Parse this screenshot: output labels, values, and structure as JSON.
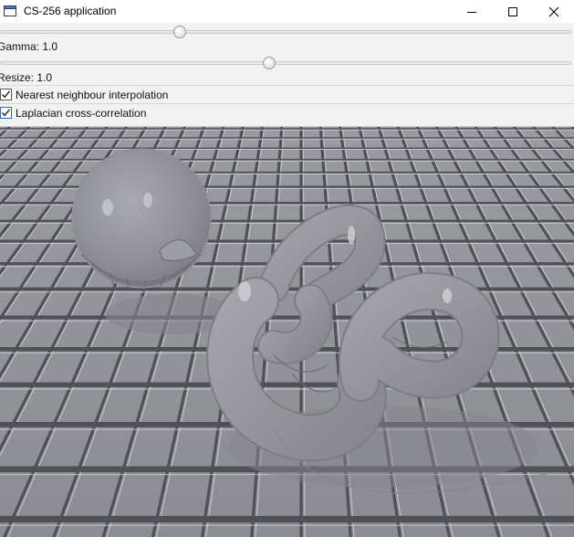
{
  "window": {
    "title": "CS-256 application",
    "controls": {
      "minimize_icon": "minimize-icon",
      "maximize_icon": "maximize-icon",
      "close_icon": "close-icon"
    }
  },
  "controls": {
    "slider1": {
      "value_fraction": 0.31
    },
    "gamma": {
      "label": "Gamma: 1.0",
      "value_fraction": 0.47
    },
    "resize": {
      "label": "Resize: 1.0"
    },
    "nearest_neighbour": {
      "label": "Nearest neighbour interpolation",
      "checked": true
    },
    "laplacian": {
      "label": "Laplacian cross-correlation",
      "checked": true
    }
  },
  "image": {
    "description_icon": "rendered-scene-image"
  },
  "colors": {
    "image_background": "#8f9095",
    "panel": "#f2f2f2"
  }
}
